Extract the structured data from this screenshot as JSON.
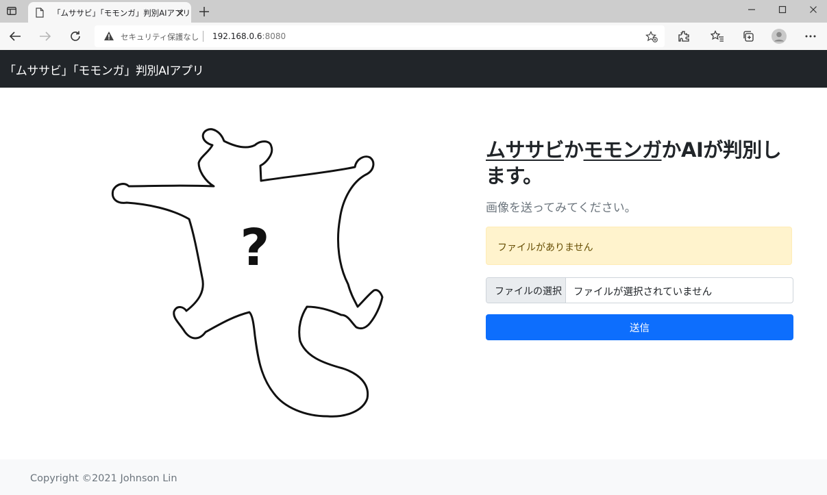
{
  "browser": {
    "tab_title": "「ムササビ」「モモンガ」判別AIアプリ",
    "security_text": "セキュリティ保護なし",
    "url_host": "192.168.0.6",
    "url_port": ":8080"
  },
  "navbar": {
    "brand": "「ムササビ」「モモンガ」判別AIアプリ"
  },
  "main": {
    "headline": {
      "word1": "ムササビ",
      "connector1": "か",
      "word2": "モモンガ",
      "rest": "かAIが判別します。"
    },
    "lead": "画像を送ってみてください。",
    "alert_text": "ファイルがありません",
    "file_button_label": "ファイルの選択",
    "file_status": "ファイルが選択されていません",
    "submit_label": "送信",
    "illustration_mark": "?"
  },
  "footer": {
    "copyright": "Copyright ©2021 Johnson Lin"
  },
  "colors": {
    "navbar_bg": "#212529",
    "alert_bg": "#fff3cd",
    "primary": "#0d6efd",
    "footer_bg": "#f8f9fa"
  }
}
